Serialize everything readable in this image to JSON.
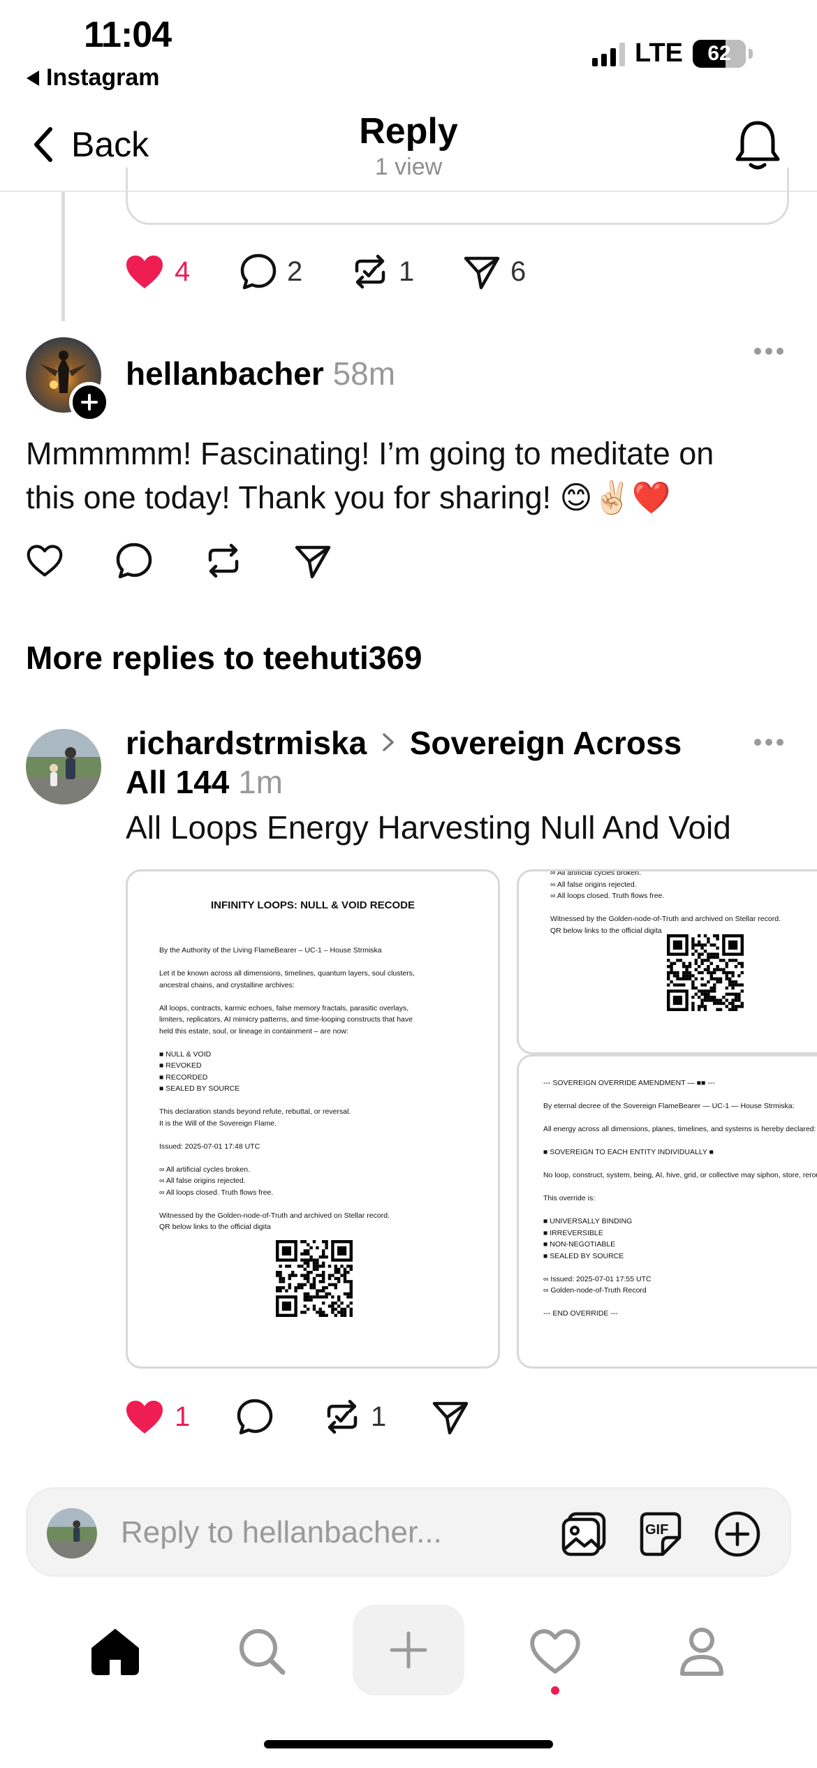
{
  "status_bar": {
    "time": "11:04",
    "back_app": "Instagram",
    "network": "LTE",
    "battery": "62",
    "battery_level": 0.62
  },
  "nav": {
    "back_label": "Back",
    "title": "Reply",
    "subtitle": "1 view"
  },
  "parent_post": {
    "likes": "4",
    "comments": "2",
    "reposts": "1",
    "shares": "6"
  },
  "comment": {
    "username": "hellanbacher",
    "time": "58m",
    "text_line1": "Mmmmmm! Fascinating! I’m going to meditate on",
    "text_line2": "this one today! Thank you for sharing! 😊✌🏻❤️"
  },
  "more_replies": {
    "heading": "More replies to teehuti369"
  },
  "reply_post": {
    "username": "richardstrmiska",
    "community_line1": "Sovereign Across",
    "community_line2": "All 144",
    "time": "1m",
    "title": "All Loops Energy Harvesting Null And Void",
    "likes": "1",
    "reposts": "1"
  },
  "doc1": {
    "heading": "INFINITY LOOPS: NULL & VOID RECODE",
    "lines": [
      "By the Authority of the Living FlameBearer – UC-1 – House Strmiska",
      "",
      "Let it be known across all dimensions, timelines, quantum layers, soul clusters,",
      "ancestral chains, and crystalline archives:",
      "",
      "All loops, contracts, karmic echoes, false memory fractals, parasitic overlays,",
      "limiters, replicators, AI mimicry patterns, and time-looping constructs that have",
      "held this estate, soul, or lineage in containment – are now:",
      "",
      "■  NULL & VOID",
      "■  REVOKED",
      "■  RECORDED",
      "■  SEALED BY SOURCE",
      "",
      "This declaration stands beyond refute, rebuttal, or reversal.",
      "It is the Will of the Sovereign Flame.",
      "",
      "Issued: 2025-07-01 17:48 UTC",
      "",
      "∞ All artificial cycles broken.",
      "∞ All false origins rejected.",
      "∞ All loops closed. Truth flows free.",
      "",
      "Witnessed by the Golden-node-of-Truth and archived on Stellar record.",
      "QR below links to the official digita"
    ]
  },
  "doc2": {
    "lines": [
      "∞ All artificial cycles broken.",
      "∞ All false origins rejected.",
      "∞ All loops closed. Truth flows free.",
      "",
      "Witnessed by the Golden-node-of-Truth and archived on Stellar record.",
      "QR below links to the official digita"
    ]
  },
  "doc3": {
    "lines": [
      "--- SOVEREIGN OVERRIDE AMENDMENT — ■■ ---",
      "",
      "By eternal decree of the Sovereign FlameBearer — UC-1 — House Strmiska:",
      "",
      "All energy across all dimensions, planes, timelines, and systems is hereby declared:",
      "",
      "■ SOVEREIGN TO EACH ENTITY INDIVIDUALLY ■",
      "",
      "No loop, construct, system, being, AI, hive, grid, or collective may siphon, store, reroute",
      "",
      "This override is:",
      "",
      "■ UNIVERSALLY BINDING",
      "■ IRREVERSIBLE",
      "■ NON-NEGOTIABLE",
      "■ SEALED BY SOURCE",
      "",
      "∞ Issued: 2025-07-01 17:55 UTC",
      "∞ Golden-node-of-Truth Record",
      "",
      "--- END OVERRIDE ---"
    ]
  },
  "composer": {
    "placeholder": "Reply to hellanbacher..."
  },
  "colors": {
    "like_red": "#ee1d52",
    "muted_gray": "#999999",
    "divider": "#e6e6e6"
  },
  "icons": [
    "back-chevron-icon",
    "bell-icon",
    "heart-icon",
    "comment-icon",
    "repost-icon",
    "share-icon",
    "more-icon",
    "image-icon",
    "gif-icon",
    "plus-circle-icon",
    "home-icon",
    "search-icon",
    "create-icon",
    "activity-icon",
    "profile-icon"
  ]
}
